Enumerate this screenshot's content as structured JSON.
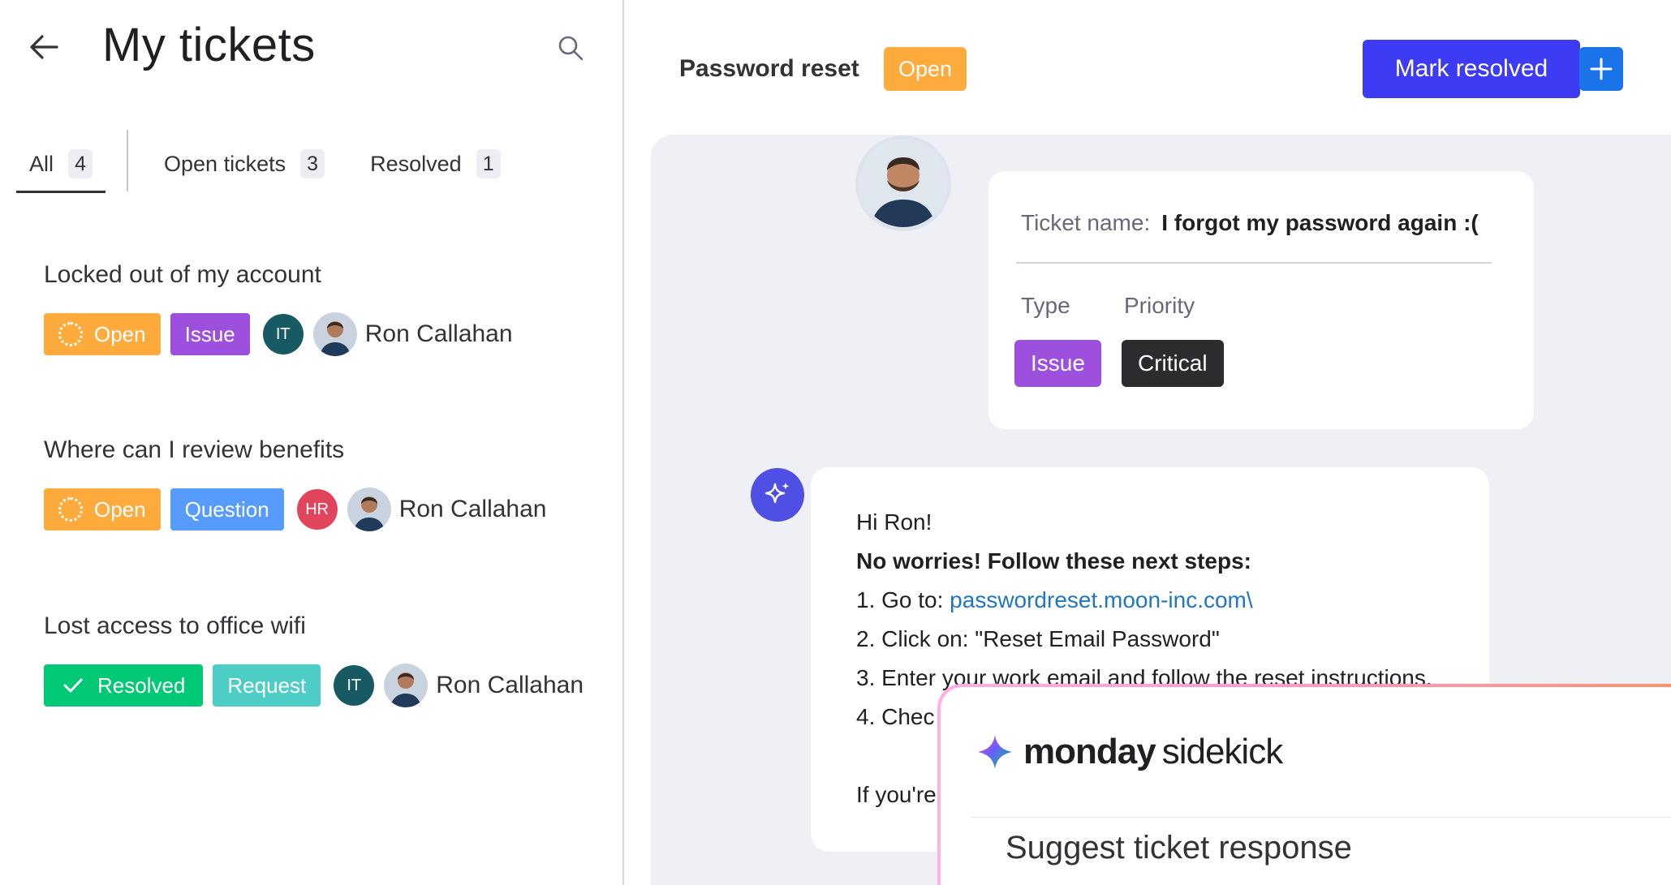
{
  "left": {
    "title": "My tickets",
    "tabs": [
      {
        "label": "All",
        "count": "4"
      },
      {
        "label": "Open tickets",
        "count": "3"
      },
      {
        "label": "Resolved",
        "count": "1"
      }
    ],
    "tickets": [
      {
        "title": "Locked out of my account",
        "status": "Open",
        "type": "Issue",
        "dept": "IT",
        "owner": "Ron Callahan"
      },
      {
        "title": "Where can I review benefits",
        "status": "Open",
        "type": "Question",
        "dept": "HR",
        "owner": "Ron Callahan"
      },
      {
        "title": "Lost access to office wifi",
        "status": "Resolved",
        "type": "Request",
        "dept": "IT",
        "owner": "Ron Callahan"
      }
    ]
  },
  "right": {
    "header_title": "Password reset",
    "header_status": "Open",
    "mark_resolved_label": "Mark resolved",
    "card": {
      "name_label": "Ticket name:",
      "name_value": "I forgot my password again :(",
      "type_label": "Type",
      "priority_label": "Priority",
      "type_value": "Issue",
      "priority_value": "Critical"
    },
    "message": {
      "greeting": "Hi Ron!",
      "intro": "No worries! Follow these next steps:",
      "step1_prefix": "1. Go to: ",
      "step1_link": "passwordreset.moon-inc.com\\",
      "step2": "2. Click on: \"Reset Email Password\"",
      "step3": "3. Enter your work email and follow the reset instructions.",
      "step4": "4. Chec",
      "closing": "If you're"
    }
  },
  "sidekick": {
    "brand": "monday",
    "product": "sidekick",
    "action": "Suggest ticket response"
  },
  "colors": {
    "open": "#fdab3d",
    "resolved": "#00c875",
    "issue": "#9d50dd",
    "question": "#579bfc",
    "request": "#4eccc6",
    "primary": "#3d3bf3"
  }
}
